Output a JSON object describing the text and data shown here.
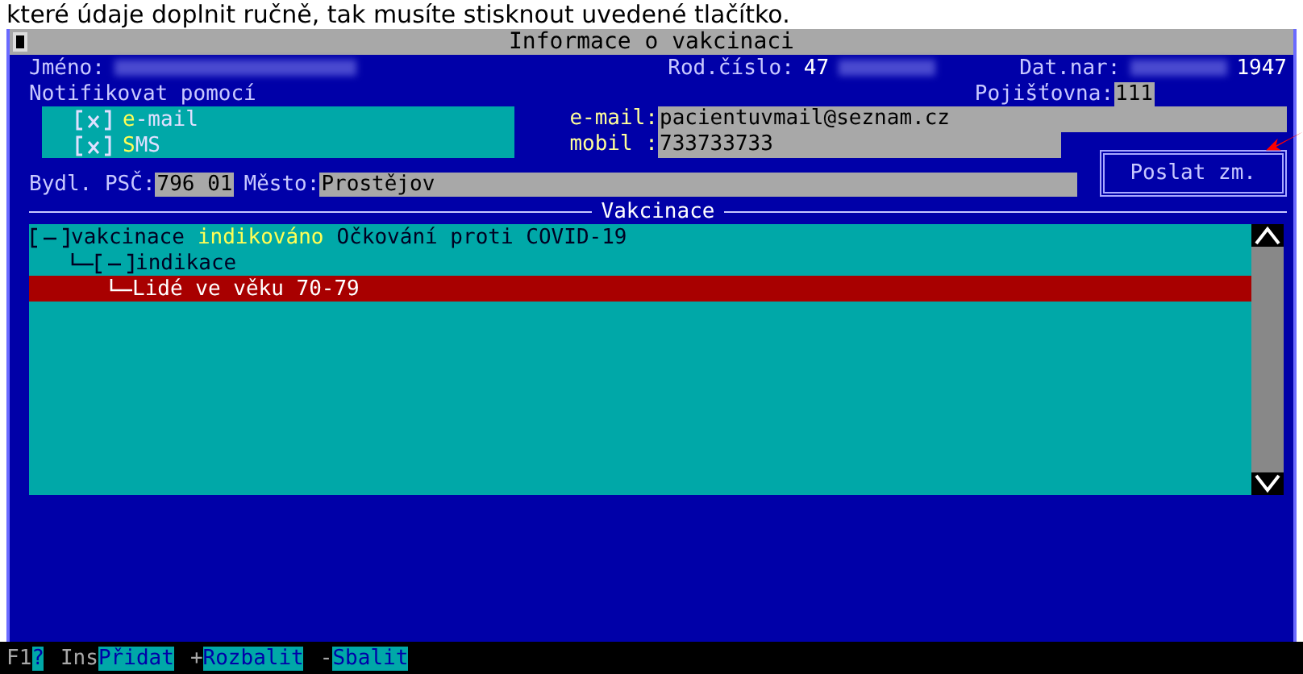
{
  "caption": "které údaje doplnit ručně, tak musíte stisknout uvedené tlačítko.",
  "window": {
    "title": "Informace o vakcinaci"
  },
  "patient": {
    "name_label": "Jméno:",
    "rc_label": "Rod.číslo:",
    "rc_value": "47",
    "dob_label": "Dat.nar:",
    "dob_value": "1947",
    "insurer_label": "Pojišťovna:",
    "insurer_value": "111"
  },
  "notify": {
    "label": "Notifikovat pomocí",
    "options": [
      {
        "label": "e-mail",
        "checked": true
      },
      {
        "label": "SMS",
        "checked": true
      }
    ]
  },
  "contacts": [
    {
      "label": "e-mail:",
      "value": "pacientuvmail@seznam.cz"
    },
    {
      "label": "mobil :",
      "value": "733733733"
    }
  ],
  "send_button": "Poslat zm.",
  "address": {
    "label": "Bydl. PSČ:",
    "zip": "796 01",
    "city_label": "Město:",
    "city": "Prostějov"
  },
  "section_title": "Vakcinace",
  "tree": [
    {
      "label": "vakcinace",
      "status": "indikováno",
      "detail": "Očkování proti COVID-19",
      "expanded": true,
      "selected": false,
      "children": [
        {
          "label": "indikace",
          "expanded": true,
          "selected": false,
          "children": [
            {
              "label": "Lidé ve věku 70-79",
              "selected": true
            }
          ]
        }
      ]
    }
  ],
  "keys": [
    {
      "key": "F1",
      "label": "?"
    },
    {
      "key": "Ins",
      "label": "Přidat"
    },
    {
      "key": "+",
      "label": "Rozbalit"
    },
    {
      "key": "-",
      "label": "Sbalit"
    }
  ]
}
